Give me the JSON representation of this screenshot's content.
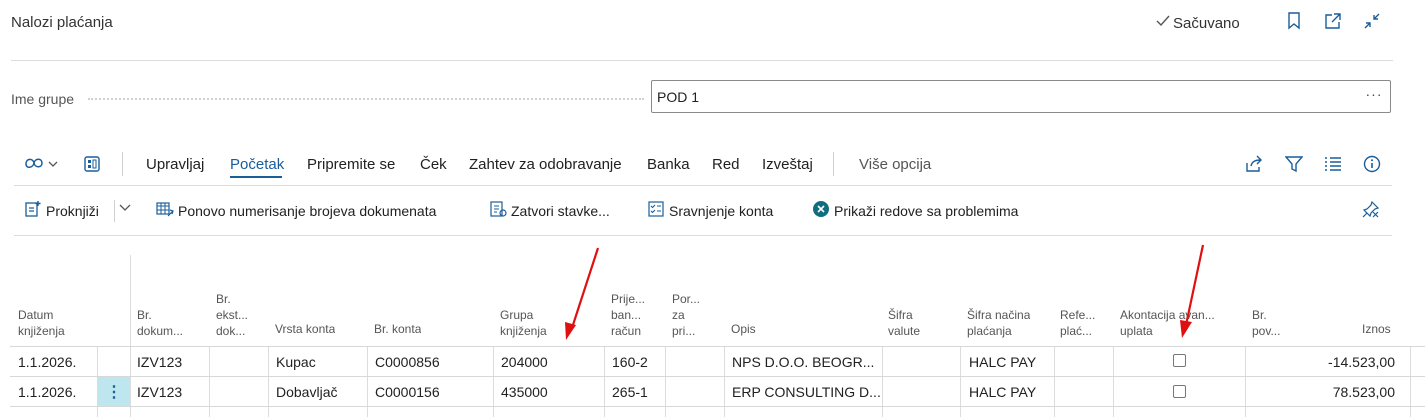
{
  "header": {
    "title": "Nalozi plaćanja",
    "saved_label": "Sačuvano",
    "icons": [
      "bookmark-icon",
      "open-in-new-window-icon",
      "collapse-icon"
    ]
  },
  "field": {
    "label": "Ime grupe",
    "value": "POD 1",
    "more": "···"
  },
  "actionbar": {
    "items": [
      "Upravljaj",
      "Početak",
      "Pripremite se",
      "Ček",
      "Zahtev za odobravanje",
      "Banka",
      "Red",
      "Izveštaj"
    ],
    "more_options": "Više opcija",
    "active": "Početak"
  },
  "commands": {
    "post": "Proknjiži",
    "renumber": "Ponovo numerisanje brojeva dokumenata",
    "close_entries": "Zatvori stavke...",
    "reconcile": "Sravnjenje konta",
    "show_problems": "Prikaži redove sa problemima"
  },
  "table": {
    "headers": {
      "posting_date": [
        "Datum",
        "knjiženja"
      ],
      "doc_no": [
        "Br.",
        "dokum..."
      ],
      "ext_doc_no": [
        "Br.",
        "ekst...",
        "dok..."
      ],
      "account_type": [
        "Vrsta konta"
      ],
      "account_no": [
        "Br. konta"
      ],
      "posting_group": [
        "Grupa",
        "knjiženja"
      ],
      "recipient_bank": [
        "Prije...",
        "ban...",
        "račun"
      ],
      "tax": [
        "Por...",
        "za",
        "pri..."
      ],
      "description": [
        "Opis"
      ],
      "currency": [
        "Šifra",
        "valute"
      ],
      "payment_method": [
        "Šifra načina",
        "plaćanja"
      ],
      "payment_ref": [
        "Refe...",
        "plać..."
      ],
      "prepayment": [
        "Akontacija avan...",
        "uplata"
      ],
      "return_no": [
        "Br.",
        "pov..."
      ],
      "amount": [
        "Iznos"
      ]
    },
    "rows": [
      {
        "posting_date": "1.1.2026.",
        "doc_no": "IZV123",
        "account_type": "Kupac",
        "account_no": "C0000856",
        "posting_group": "204000",
        "recipient_bank": "160-2",
        "description": "NPS D.O.O. BEOGR...",
        "payment_method": "HALC PAY",
        "prepayment": false,
        "amount": "-14.523,00"
      },
      {
        "posting_date": "1.1.2026.",
        "doc_no": "IZV123",
        "account_type": "Dobavljač",
        "account_no": "C0000156",
        "posting_group": "435000",
        "recipient_bank": "265-1",
        "description": "ERP CONSULTING D...",
        "payment_method": "HALC PAY",
        "prepayment": false,
        "amount": "78.523,00"
      }
    ]
  },
  "colors": {
    "accent": "#1a5d9b",
    "row_selected": "#bde6ef",
    "annotation_arrow": "#e01010"
  }
}
